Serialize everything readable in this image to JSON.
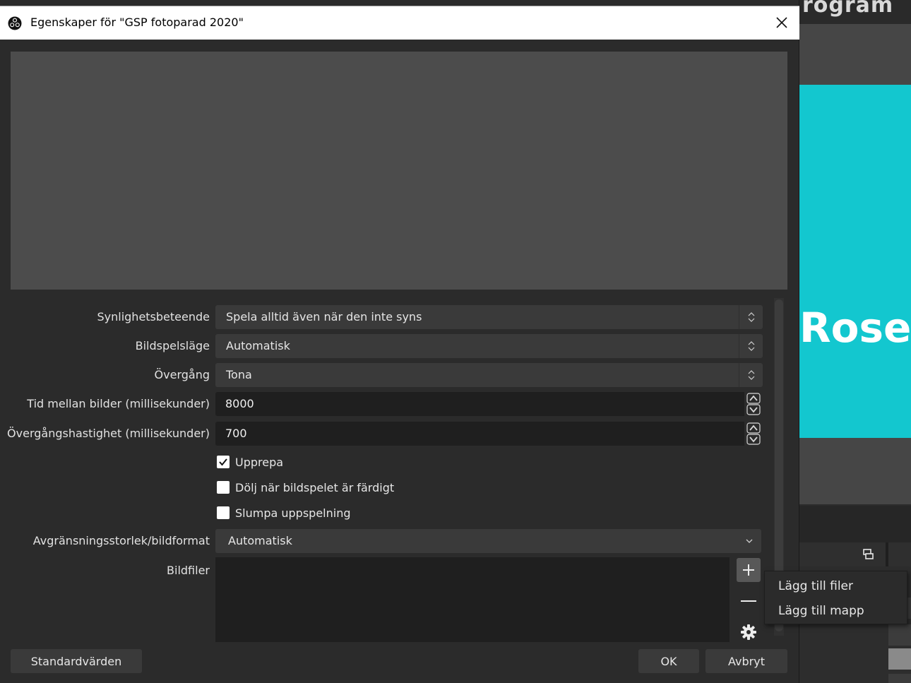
{
  "background_window": {
    "title_fragment": "rogram",
    "preview_text": "Rose",
    "preview_color": "#13c7cf"
  },
  "dialog": {
    "title": "Egenskaper för \"GSP fotoparad 2020\"",
    "app_icon": "obs-logo-icon",
    "close_icon": "close-icon"
  },
  "properties": {
    "visibility": {
      "label": "Synlighetsbeteende",
      "value": "Spela alltid även när den inte syns"
    },
    "slide_mode": {
      "label": "Bildspelsläge",
      "value": "Automatisk"
    },
    "transition": {
      "label": "Övergång",
      "value": "Tona"
    },
    "slide_time": {
      "label": "Tid mellan bilder (millisekunder)",
      "value": "8000"
    },
    "transition_speed": {
      "label": "Övergångshastighet (millisekunder)",
      "value": "700"
    },
    "loop": {
      "label": "Upprepa",
      "checked": true
    },
    "hide_when_done": {
      "label": "Dölj när bildspelet är färdigt",
      "checked": false
    },
    "randomize": {
      "label": "Slumpa uppspelning",
      "checked": false
    },
    "bounding_size": {
      "label": "Avgränsningsstorlek/bildformat",
      "value": "Automatisk"
    },
    "files": {
      "label": "Bildfiler"
    }
  },
  "context_menu": {
    "items": [
      "Lägg till filer",
      "Lägg till mapp"
    ]
  },
  "buttons": {
    "defaults": "Standardvärden",
    "ok": "OK",
    "cancel": "Avbryt"
  }
}
